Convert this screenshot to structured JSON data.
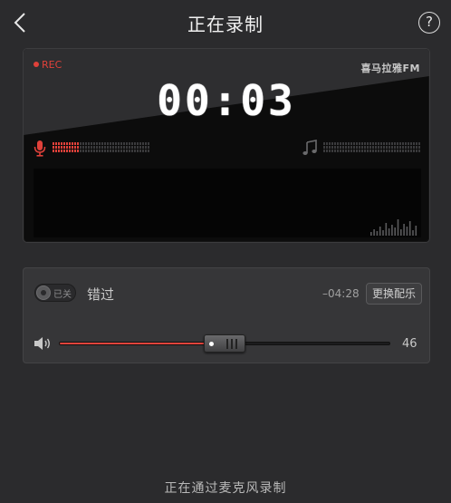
{
  "header": {
    "title": "正在录制",
    "help_label": "?"
  },
  "recorder": {
    "rec_label": "REC",
    "brand": "喜马拉雅FM",
    "timer": "00:03",
    "mic_level": 0.28,
    "music_level": 0.0
  },
  "music": {
    "toggle_label": "已关",
    "song_name": "错过",
    "remaining": "–04:28",
    "change_button": "更换配乐",
    "volume": 46,
    "volume_max": 100
  },
  "footer": {
    "status": "正在通过麦克风录制"
  },
  "colors": {
    "accent": "#e0413a",
    "background": "#2b2b2d"
  },
  "icons": {
    "back": "chevron-left-icon",
    "help": "question-circle-icon",
    "mic": "microphone-icon",
    "music": "music-note-icon",
    "speaker": "speaker-icon"
  }
}
